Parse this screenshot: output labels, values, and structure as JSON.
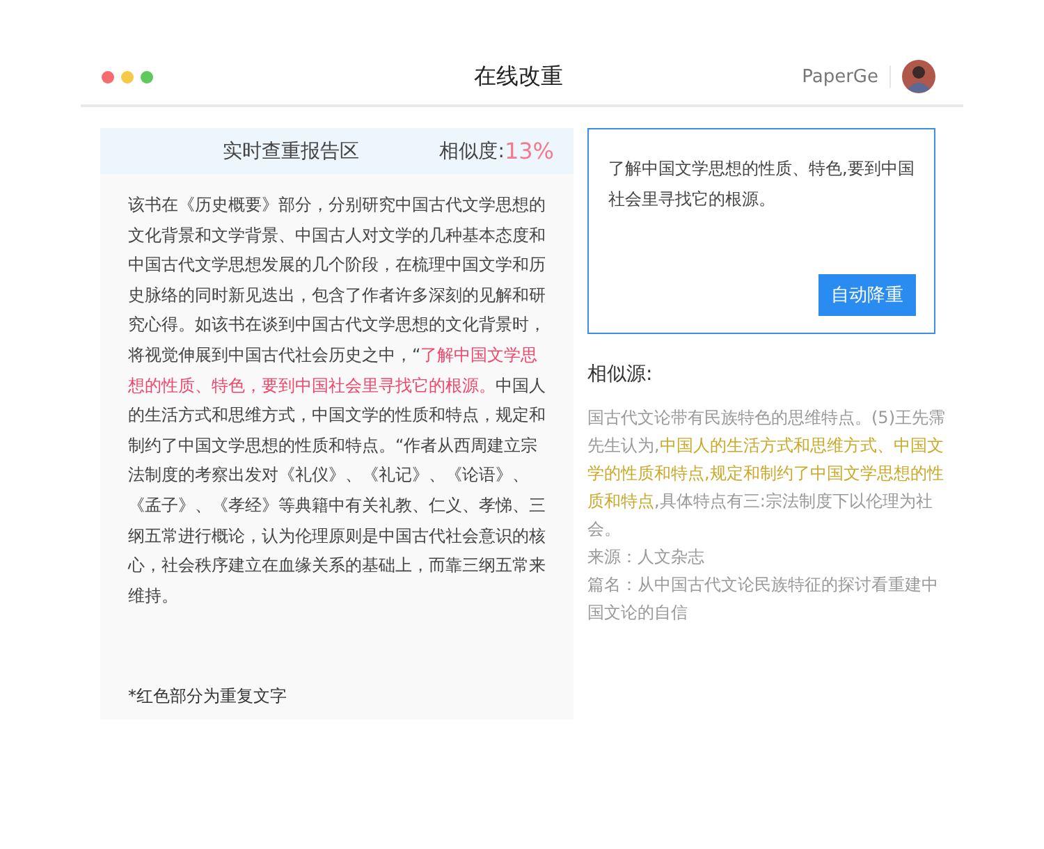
{
  "window": {
    "title": "在线改重",
    "user": "PaperGe"
  },
  "report": {
    "title": "实时查重报告区",
    "similarity_label": "相似度:",
    "similarity_value": "13%",
    "segments": [
      {
        "text": "该书在《历史概要》部分，分别研究中国古代文学思想的文化背景和文学背景、中国古人对文学的几种基本态度和中国古代文学思想发展的几个阶段，在梳理中国文学和历史脉络的同时新见迭出，包含了作者许多深刻的见解和研究心得。如该书在谈到中国古代文学思想的文化背景时，将视觉伸展到中国古代社会历史之中，“",
        "repeated": false
      },
      {
        "text": "了解中国文学思想的性质、特色，要到中国社会里寻找它的根源。",
        "repeated": true
      },
      {
        "text": "中国人的生活方式和思维方式，中国文学的性质和特点，规定和制约了中国文学思想的性质和特点。“作者从西周建立宗法制度的考察出发对《礼仪》、《礼记》、《论语》、《孟子》、《孝经》等典籍中有关礼教、仁义、孝悌、三纲五常进行概论，认为伦理原则是中国古代社会意识的核心，社会秩序建立在血缘关系的基础上，而靠三纲五常来维持。",
        "repeated": false
      }
    ],
    "note": "*红色部分为重复文字"
  },
  "editor": {
    "value": "了解中国文学思想的性质、特色,要到中国社会里寻找它的根源。",
    "button": "自动降重"
  },
  "sources": {
    "title": "相似源:",
    "segments": [
      {
        "text": "国古代文论带有民族特色的思维特点。(5)王先霈先生认为,",
        "matched": false
      },
      {
        "text": "中国人的生活方式和思维方式、中国文学的性质和特点,规定和制约了中国文学思想的性质和特点",
        "matched": true
      },
      {
        "text": ",具体特点有三:宗法制度下以伦理为社会。",
        "matched": false
      }
    ],
    "source": "来源：人文杂志",
    "article": "篇名：从中国古代文论民族特征的探讨看重建中国文论的自信"
  }
}
